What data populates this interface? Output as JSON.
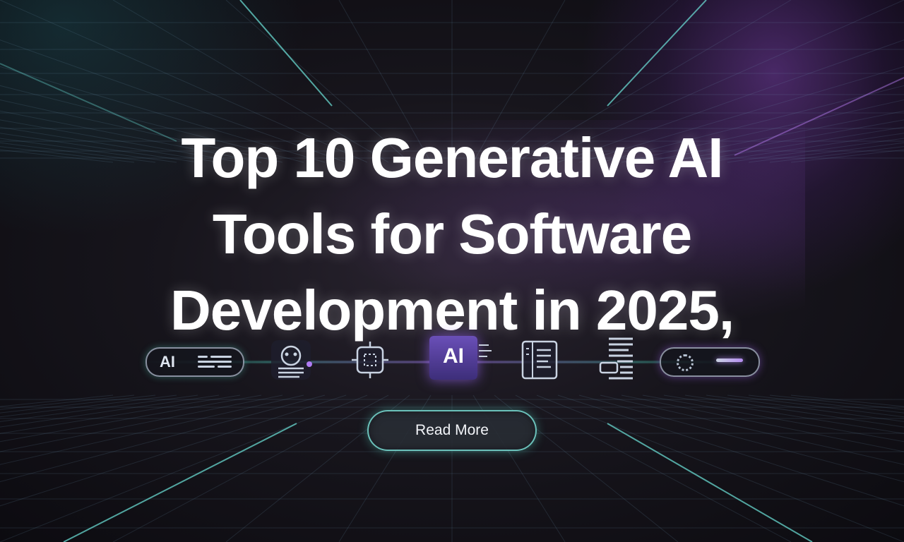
{
  "hero": {
    "title_lines": [
      "Top 10 Generative AI",
      "Tools for Software",
      "Development in 2025,"
    ]
  },
  "icons": {
    "left_pill_text": "AI",
    "ai_chip_text": "AI",
    "items": [
      "ai-pill-icon",
      "robot-head-icon",
      "chip-icon",
      "ai-chip-icon",
      "document-icon",
      "printer-list-icon",
      "gear-toggle-icon"
    ]
  },
  "cta": {
    "label": "Read More"
  },
  "colors": {
    "background": "#141218",
    "accent_teal": "#5adcc8",
    "accent_purple": "#a064f0",
    "text": "#ffffff"
  }
}
